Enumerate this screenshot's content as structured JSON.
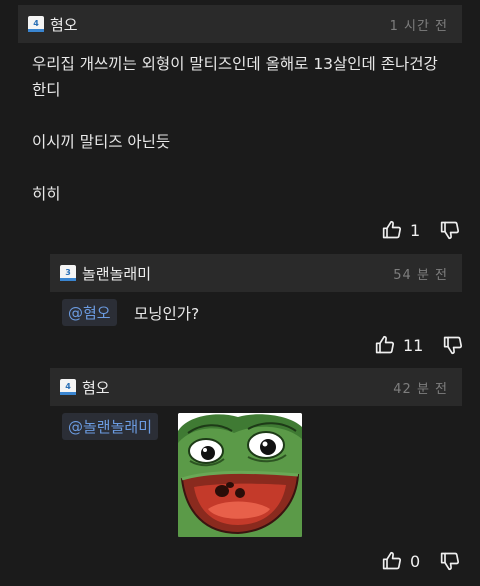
{
  "comments": [
    {
      "author": "혐오",
      "level": "4",
      "time": "1 시간 전",
      "lines": [
        "우리집 개쓰끼는 외형이 말티즈인데 올해로 13살인데 존나건강",
        "한디",
        "",
        "이시끼 말티즈 아닌듯",
        "",
        "히히"
      ],
      "likes": "1"
    },
    {
      "author": "놀랜놀래미",
      "level": "3",
      "time": "54 분 전",
      "mention": "@혐오",
      "text": "모닝인가?",
      "likes": "11"
    },
    {
      "author": "혐오",
      "level": "4",
      "time": "42 분 전",
      "mention": "@놀랜놀래미",
      "likes": "0"
    }
  ],
  "colors": {
    "background": "#1b1b1b",
    "header": "#2a2a2a",
    "mention_text": "#6b9be0",
    "time_text": "#7e7e7e"
  },
  "icons": [
    "thumbs-up-icon",
    "thumbs-down-icon",
    "level-badge-icon"
  ]
}
